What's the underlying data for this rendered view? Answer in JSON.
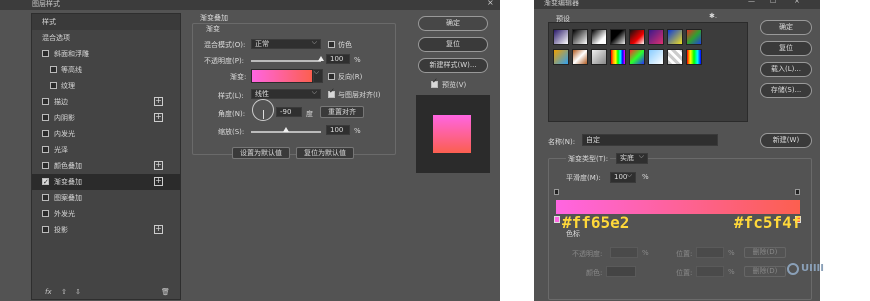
{
  "layer_style": {
    "title": "图层样式",
    "close": "×",
    "styles_panel": {
      "header": "样式",
      "blend_options": "混合选项",
      "items": [
        {
          "label": "斜面和浮雕",
          "checked": false,
          "plus": false,
          "indent": false
        },
        {
          "label": "等高线",
          "checked": false,
          "plus": false,
          "indent": true
        },
        {
          "label": "纹理",
          "checked": false,
          "plus": false,
          "indent": true
        },
        {
          "label": "描边",
          "checked": false,
          "plus": true,
          "indent": false
        },
        {
          "label": "内阴影",
          "checked": false,
          "plus": true,
          "indent": false
        },
        {
          "label": "内发光",
          "checked": false,
          "plus": false,
          "indent": false
        },
        {
          "label": "光泽",
          "checked": false,
          "plus": false,
          "indent": false
        },
        {
          "label": "颜色叠加",
          "checked": false,
          "plus": true,
          "indent": false
        },
        {
          "label": "渐变叠加",
          "checked": true,
          "plus": true,
          "indent": false
        },
        {
          "label": "图案叠加",
          "checked": false,
          "plus": false,
          "indent": false
        },
        {
          "label": "外发光",
          "checked": false,
          "plus": false,
          "indent": false
        },
        {
          "label": "投影",
          "checked": false,
          "plus": true,
          "indent": false
        }
      ],
      "footer": {
        "fx": "fx",
        "up": "⇧",
        "down": "⇩",
        "trash": "🗑"
      }
    },
    "gradient_overlay": {
      "section_title": "渐变叠加",
      "group_title": "渐变",
      "blend_mode_label": "混合模式(O):",
      "blend_mode_value": "正常",
      "dither_label": "仿色",
      "opacity_label": "不透明度(P):",
      "opacity_value": "100",
      "opacity_fraction": 1.0,
      "percent": "%",
      "gradient_label": "渐变:",
      "reverse_label": "反向(R)",
      "style_label": "样式(L):",
      "style_value": "线性",
      "align_label": "与图层对齐(I)",
      "angle_label": "角度(N):",
      "angle_value": "-90",
      "degree": "度",
      "reset_align": "重置对齐",
      "scale_label": "缩放(S):",
      "scale_value": "100",
      "scale_fraction": 0.5,
      "set_default": "设置为默认值",
      "reset_default": "复位为默认值"
    },
    "buttons": {
      "ok": "确定",
      "reset": "复位",
      "new_style": "新建样式(W)...",
      "preview": "预览(V)"
    },
    "colors": {
      "start": "#ff65e2",
      "end": "#fc5f4f"
    }
  },
  "gradient_editor": {
    "title": "渐变编辑器",
    "window_controls": {
      "min": "—",
      "max": "☐",
      "close": "×"
    },
    "presets_label": "预设",
    "gear": "✱.",
    "buttons": {
      "ok": "确定",
      "reset": "复位",
      "load": "载入(L)...",
      "save": "存储(S)..."
    },
    "name_label": "名称(N):",
    "name_value": "自定",
    "new_button": "新建(W)",
    "type_label": "渐变类型(T):",
    "type_value": "实底",
    "smooth_label": "平滑度(M):",
    "smooth_value": "100",
    "percent": "%",
    "hex_start": "#ff65e2",
    "hex_end": "#fc5f4f",
    "hex_color": "#ffd83a",
    "stops_group": "色标",
    "opacity_label": "不透明度:",
    "location_label": "位置:",
    "delete_label": "删除(D)",
    "color_label": "颜色:",
    "watermark": "UIIII"
  }
}
